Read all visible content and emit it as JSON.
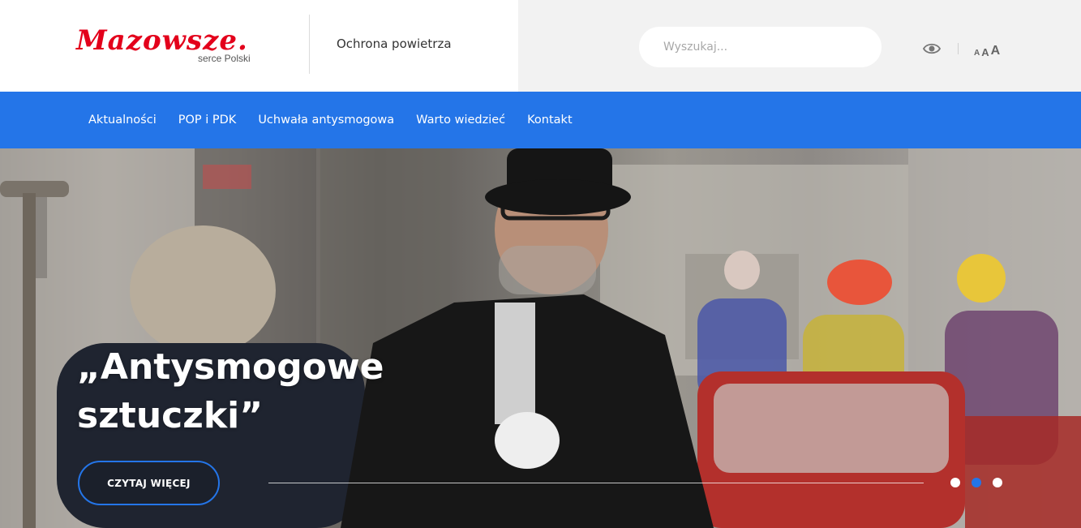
{
  "header": {
    "logo_text": "Mazowsze.",
    "logo_subtitle": "serce Polski",
    "section_title": "Ochrona powietrza",
    "search": {
      "placeholder": "Wyszukaj..."
    },
    "tools": {
      "eye_icon": "eye-icon",
      "font_small": "A",
      "font_medium": "A",
      "font_large": "A"
    }
  },
  "nav": {
    "items": [
      {
        "label": "Aktualności"
      },
      {
        "label": "POP i PDK"
      },
      {
        "label": "Uchwała antysmogowa"
      },
      {
        "label": "Warto wiedzieć"
      },
      {
        "label": "Kontakt"
      }
    ]
  },
  "hero": {
    "title_line1": "„Antysmogowe",
    "title_line2": "sztuczki”",
    "button_label": "CZYTAJ WIĘCEJ",
    "slides_count": 3,
    "active_slide": 2
  },
  "colors": {
    "brand_red": "#e3001b",
    "nav_blue": "#2475e8",
    "header_gray": "#f2f2f2"
  }
}
